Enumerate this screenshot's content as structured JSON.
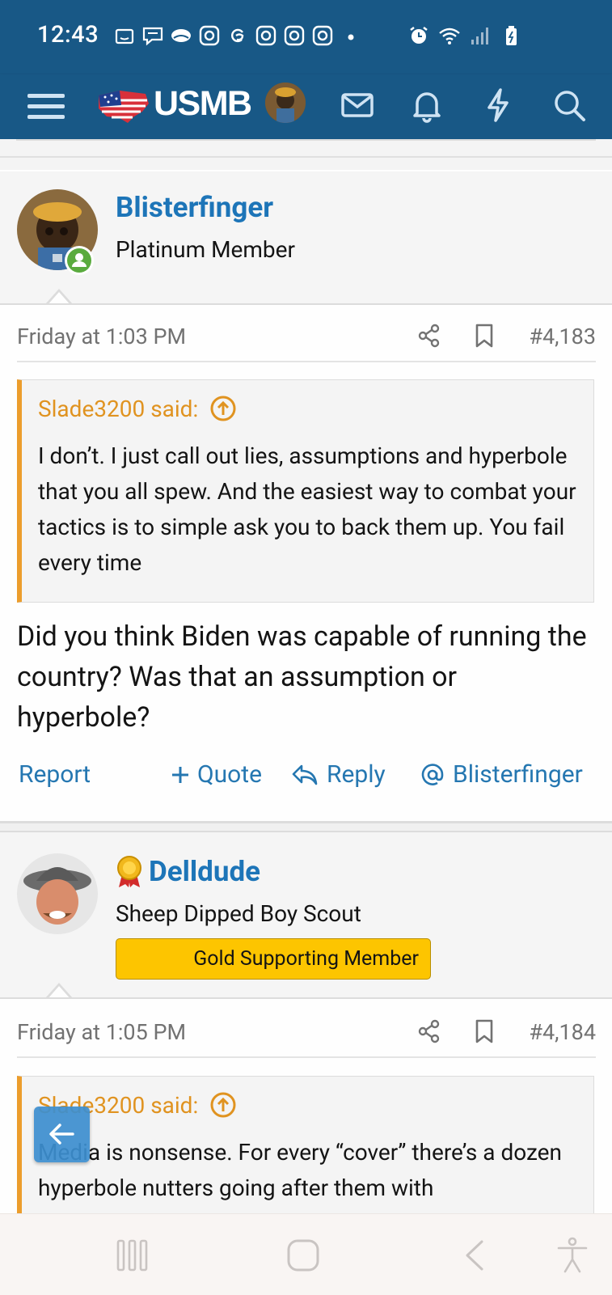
{
  "status_bar": {
    "time": "12:43"
  },
  "app_bar": {
    "logo_text": "USMB",
    "icons": [
      "menu-icon",
      "mail-icon",
      "bell-icon",
      "lightning-icon",
      "search-icon"
    ]
  },
  "posts": [
    {
      "username": "Blisterfinger",
      "user_title": "Platinum Member",
      "online": true,
      "date": "Friday at 1:03 PM",
      "post_number": "#4,183",
      "quote_author": "Slade3200 said:",
      "quote_text": "I don’t. I just call out lies, assumptions and hyperbole that you all spew. And the easiest way to combat your tactics is to simple ask you to back them up. You fail every time",
      "body": "Did you think Biden was capable of running the country? Was that an assumption or hyperbole?",
      "actions": {
        "report": "Report",
        "quote": "Quote",
        "reply": "Reply",
        "mention": "Blisterfinger"
      }
    },
    {
      "username": "Delldude",
      "user_title": "Sheep Dipped Boy Scout",
      "badge": "Gold Supporting Member",
      "date": "Friday at 1:05 PM",
      "post_number": "#4,184",
      "quote_author": "Slade3200 said:",
      "quote_text": "Media is nonsense. For every “cover” there’s a dozen hyperbole nutters going after them with"
    }
  ],
  "colors": {
    "header_bg": "#185886",
    "link_blue": "#1d75b8",
    "quote_accent": "#ec9d2c",
    "gold_badge": "#fdc500",
    "online_green": "#5aab3e"
  }
}
